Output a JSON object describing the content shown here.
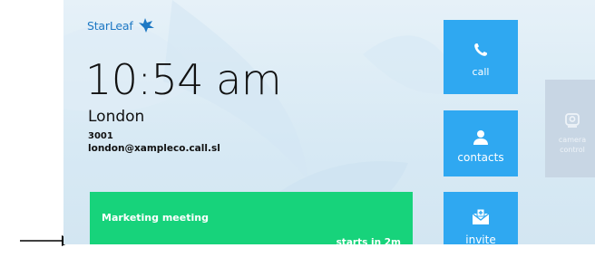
{
  "brand": {
    "name": "StarLeaf",
    "icon": "leaf-logo-icon"
  },
  "status": {
    "time": "10:54 am",
    "location": "London",
    "extension": "3001",
    "address": "london@xampleco.call.sl"
  },
  "meeting": {
    "title": "Marketing meeting",
    "starts": "starts in 2m"
  },
  "actions": {
    "call": {
      "label": "call",
      "icon": "phone-icon"
    },
    "contacts": {
      "label": "contacts",
      "icon": "person-icon"
    },
    "invite": {
      "label": "invite",
      "icon": "envelope-plus-icon"
    },
    "camera_control": {
      "label_line1": "camera",
      "label_line2": "control",
      "icon": "camera-lens-icon"
    }
  },
  "colors": {
    "tile_blue": "#2fa8f1",
    "meeting_green": "#17d37b",
    "camera_tile": "#c8d6e4",
    "brand_blue": "#1e79c4"
  }
}
